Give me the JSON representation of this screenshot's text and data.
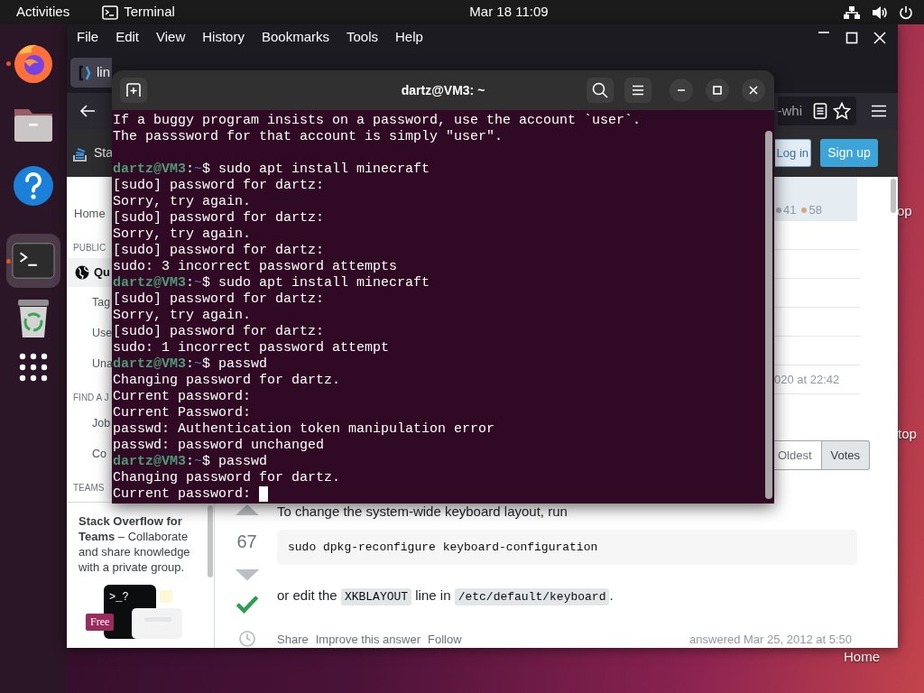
{
  "top_bar": {
    "activities": "Activities",
    "app_name": "Terminal",
    "clock": "Mar 18  11:09"
  },
  "dock": [
    {
      "kind": "firefox",
      "running": true,
      "active": false
    },
    {
      "kind": "files",
      "running": false,
      "active": false
    },
    {
      "kind": "help",
      "running": false,
      "active": false
    },
    {
      "kind": "terminal",
      "running": true,
      "active": true
    },
    {
      "kind": "trash",
      "running": false,
      "active": false
    }
  ],
  "browser": {
    "menu": [
      "File",
      "Edit",
      "View",
      "History",
      "Bookmarks",
      "Tools",
      "Help"
    ],
    "tab": {
      "title": "lin"
    },
    "url": "-whi",
    "site_header": {
      "logo_text": "Sta",
      "login": "Log in",
      "signup": "Sign up"
    },
    "sidebar": [
      {
        "kind": "link",
        "label": "Home",
        "selected": false
      },
      {
        "kind": "heading",
        "label": "PUBLIC"
      },
      {
        "kind": "primary",
        "label": "Qu",
        "selected": true
      },
      {
        "kind": "sublink",
        "label": "Tag",
        "selected": false
      },
      {
        "kind": "sublink",
        "label": "Use",
        "selected": false
      },
      {
        "kind": "sublink",
        "label": "Una",
        "selected": false
      },
      {
        "kind": "heading",
        "label": "FIND A J"
      },
      {
        "kind": "sublink",
        "label": "Job",
        "selected": false
      },
      {
        "kind": "sublink",
        "label": "Co",
        "selected": false
      },
      {
        "kind": "heading",
        "label": "TEAMS"
      }
    ],
    "teams_promo": {
      "text": "**Stack Overflow for Teams** – Collaborate and share knowledge with a private group.",
      "prompt": ">_?",
      "badge": "Free"
    },
    "aside": {
      "badges": [
        {
          "count": "41",
          "color": "#a3a8ad"
        },
        {
          "count": "58",
          "color": "#d6a77e"
        }
      ],
      "date": "020 at 22:42"
    },
    "sort": [
      {
        "label": "Oldest",
        "selected": false
      },
      {
        "label": "Votes",
        "selected": true
      }
    ],
    "answer": {
      "intro": "To change the system-wide keyboard layout, run",
      "score": "67",
      "accepted": true,
      "code": "sudo dpkg-reconfigure keyboard-configuration",
      "parts": [
        {
          "text": "or edit the ",
          "code": false
        },
        {
          "text": "XKBLAYOUT",
          "code": true
        },
        {
          "text": " line in ",
          "code": false
        },
        {
          "text": "/etc/default/keyboard",
          "code": true
        },
        {
          "text": ".",
          "code": false
        }
      ],
      "actions": [
        "Share",
        "Improve this answer",
        "Follow"
      ],
      "answered": "answered Mar 25, 2012 at 5:50"
    }
  },
  "terminal": {
    "title": "dartz@VM3: ~",
    "lines": [
      {
        "kind": "output",
        "text": "If a buggy program insists on a password, use the account `user`."
      },
      {
        "kind": "output",
        "text": "The passsword for that account is simply \"user\"."
      },
      {
        "kind": "blank"
      },
      {
        "kind": "prompt",
        "user": "dartz@VM3",
        "sep": ":",
        "path": "~",
        "cmd": "$ sudo apt install minecraft"
      },
      {
        "kind": "output",
        "text": "[sudo] password for dartz:"
      },
      {
        "kind": "output",
        "text": "Sorry, try again."
      },
      {
        "kind": "output",
        "text": "[sudo] password for dartz:"
      },
      {
        "kind": "output",
        "text": "Sorry, try again."
      },
      {
        "kind": "output",
        "text": "[sudo] password for dartz:"
      },
      {
        "kind": "output",
        "text": "sudo: 3 incorrect password attempts"
      },
      {
        "kind": "prompt",
        "user": "dartz@VM3",
        "sep": ":",
        "path": "~",
        "cmd": "$ sudo apt install minecraft"
      },
      {
        "kind": "output",
        "text": "[sudo] password for dartz:"
      },
      {
        "kind": "output",
        "text": "Sorry, try again."
      },
      {
        "kind": "output",
        "text": "[sudo] password for dartz:"
      },
      {
        "kind": "output",
        "text": "sudo: 1 incorrect password attempt"
      },
      {
        "kind": "prompt",
        "user": "dartz@VM3",
        "sep": ":",
        "path": "~",
        "cmd": "$ passwd"
      },
      {
        "kind": "output",
        "text": "Changing password for dartz."
      },
      {
        "kind": "output",
        "text": "Current password:"
      },
      {
        "kind": "output",
        "text": "Current Password:"
      },
      {
        "kind": "output",
        "text": "passwd: Authentication token manipulation error"
      },
      {
        "kind": "output",
        "text": "passwd: password unchanged"
      },
      {
        "kind": "prompt",
        "user": "dartz@VM3",
        "sep": ":",
        "path": "~",
        "cmd": "$ passwd"
      },
      {
        "kind": "output",
        "text": "Changing password for dartz."
      },
      {
        "kind": "output",
        "text": "Current password: ",
        "cursor": true
      }
    ]
  },
  "desktop_labels": [
    "op",
    "top",
    "Home"
  ]
}
